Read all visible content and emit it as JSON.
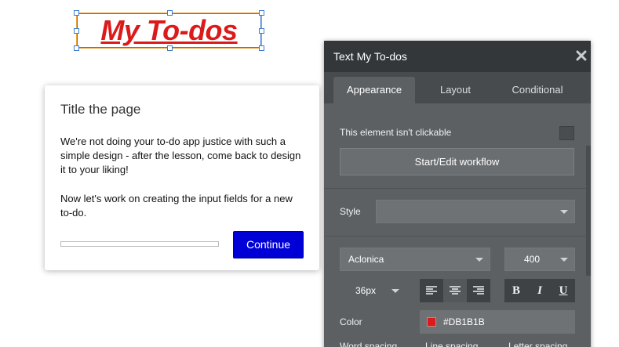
{
  "canvas_element": {
    "text": "My To-dos",
    "color": "#DB1B1B"
  },
  "lesson": {
    "title": "Title the page",
    "paragraph1": "We're not doing your to-do app justice with such a simple design - after the lesson, come back to design it to your liking!",
    "paragraph2": "Now let's work on creating the input fields for a new to-do.",
    "continue_label": "Continue",
    "progress_fraction": 0.0
  },
  "panel": {
    "title": "Text My To-dos",
    "close_icon": "close-icon",
    "tabs": [
      "Appearance",
      "Layout",
      "Conditional"
    ],
    "active_tab": "Appearance",
    "not_clickable_label": "This element isn't clickable",
    "workflow_button": "Start/Edit workflow",
    "style_label": "Style",
    "style_value": "",
    "font_family": "Aclonica",
    "font_weight": "400",
    "font_size": "36px",
    "align_icons": [
      "align-left-icon",
      "align-center-icon",
      "align-right-icon"
    ],
    "active_align": "align-center-icon",
    "format_buttons": {
      "bold": "B",
      "italic": "I",
      "underline": "U"
    },
    "color_label": "Color",
    "color_value": "#DB1B1B",
    "bottom_labels": [
      "Word spacing",
      "Line spacing",
      "Letter spacing"
    ]
  }
}
